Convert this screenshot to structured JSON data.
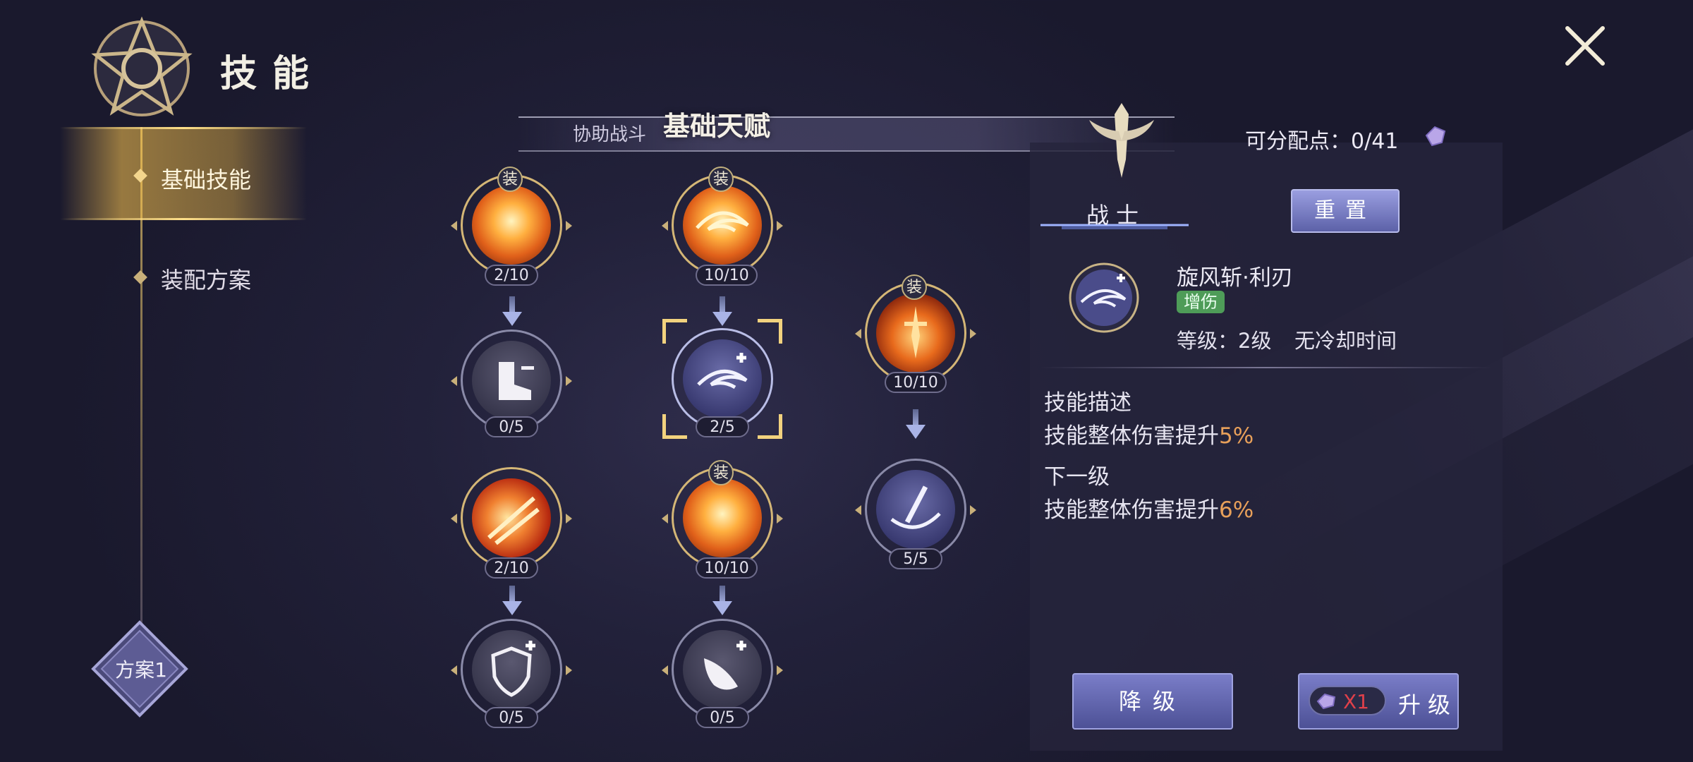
{
  "header": {
    "title": "技能"
  },
  "nav": {
    "items": [
      {
        "label": "基础技能",
        "active": true
      },
      {
        "label": "装配方案",
        "active": false
      }
    ]
  },
  "plan": {
    "label": "方案1"
  },
  "banner": {
    "sub_label": "协助战斗",
    "title": "基础天赋"
  },
  "tree": {
    "equip_badge": "装",
    "nodes": [
      {
        "level": "2/10",
        "equipped": true
      },
      {
        "level": "10/10",
        "equipped": true
      },
      {
        "level": "0/5",
        "equipped": false
      },
      {
        "level": "2/5",
        "equipped": false,
        "selected": true
      },
      {
        "level": "10/10",
        "equipped": true
      },
      {
        "level": "2/10",
        "equipped": false
      },
      {
        "level": "10/10",
        "equipped": true
      },
      {
        "level": "5/5",
        "equipped": false
      },
      {
        "level": "0/5",
        "equipped": false
      },
      {
        "level": "0/5",
        "equipped": false
      }
    ]
  },
  "panel": {
    "points": "可分配点：0/41",
    "class_label": "战士",
    "reset_label": "重置",
    "skill_name": "旋风斩·利刃",
    "tag": "增伤",
    "level_text": "等级：2级",
    "cooldown_text": "无冷却时间",
    "desc_title": "技能描述",
    "desc_prefix": "技能整体伤害提升",
    "desc_value": "5%",
    "next_title": "下一级",
    "next_prefix": "技能整体伤害提升",
    "next_value": "6%",
    "downgrade_label": "降级",
    "upgrade_label": "升级",
    "cost_label": "X1"
  },
  "colors": {
    "accent_gold": "#f2d27e",
    "highlight": "#e8a05a",
    "tag_green": "#4e9c58",
    "button_blue": "#6a6eb8"
  }
}
